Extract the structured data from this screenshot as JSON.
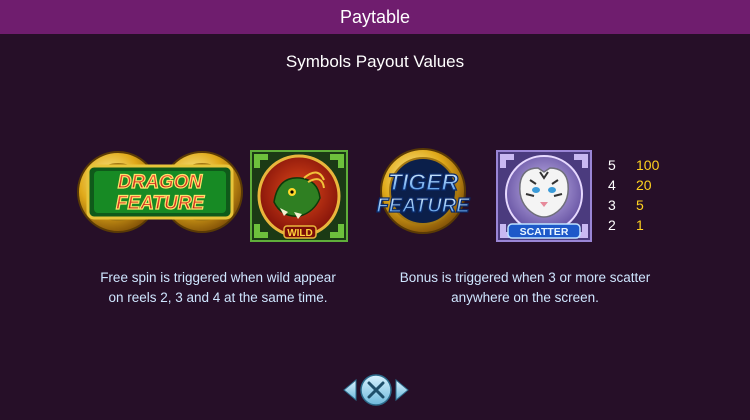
{
  "header": {
    "title": "Paytable"
  },
  "section": {
    "title": "Symbols Payout Values"
  },
  "symbols": {
    "dragon_feature": {
      "line1": "DRAGON",
      "line2": "FEATURE"
    },
    "wild": {
      "label": "WILD"
    },
    "tiger_feature": {
      "line1": "TIGER",
      "line2": "FEATURE"
    },
    "scatter": {
      "label": "SCATTER"
    }
  },
  "descriptions": {
    "wild": {
      "line1": "Free spin is triggered when wild appear",
      "line2": "on reels 2, 3 and 4 at the same time."
    },
    "scatter": {
      "line1": "Bonus is triggered when 3 or more scatter",
      "line2": "anywhere on the screen."
    }
  },
  "scatter_payouts": [
    {
      "count": "5",
      "value": "100"
    },
    {
      "count": "4",
      "value": "20"
    },
    {
      "count": "3",
      "value": "5"
    },
    {
      "count": "2",
      "value": "1"
    }
  ],
  "colors": {
    "background": "#260f28",
    "header": "#6f1d6e",
    "payout_value": "#ffd21f",
    "description_text": "#cfe6ff",
    "button": "#8fd3ec"
  },
  "icons": {
    "close": "close-icon"
  }
}
